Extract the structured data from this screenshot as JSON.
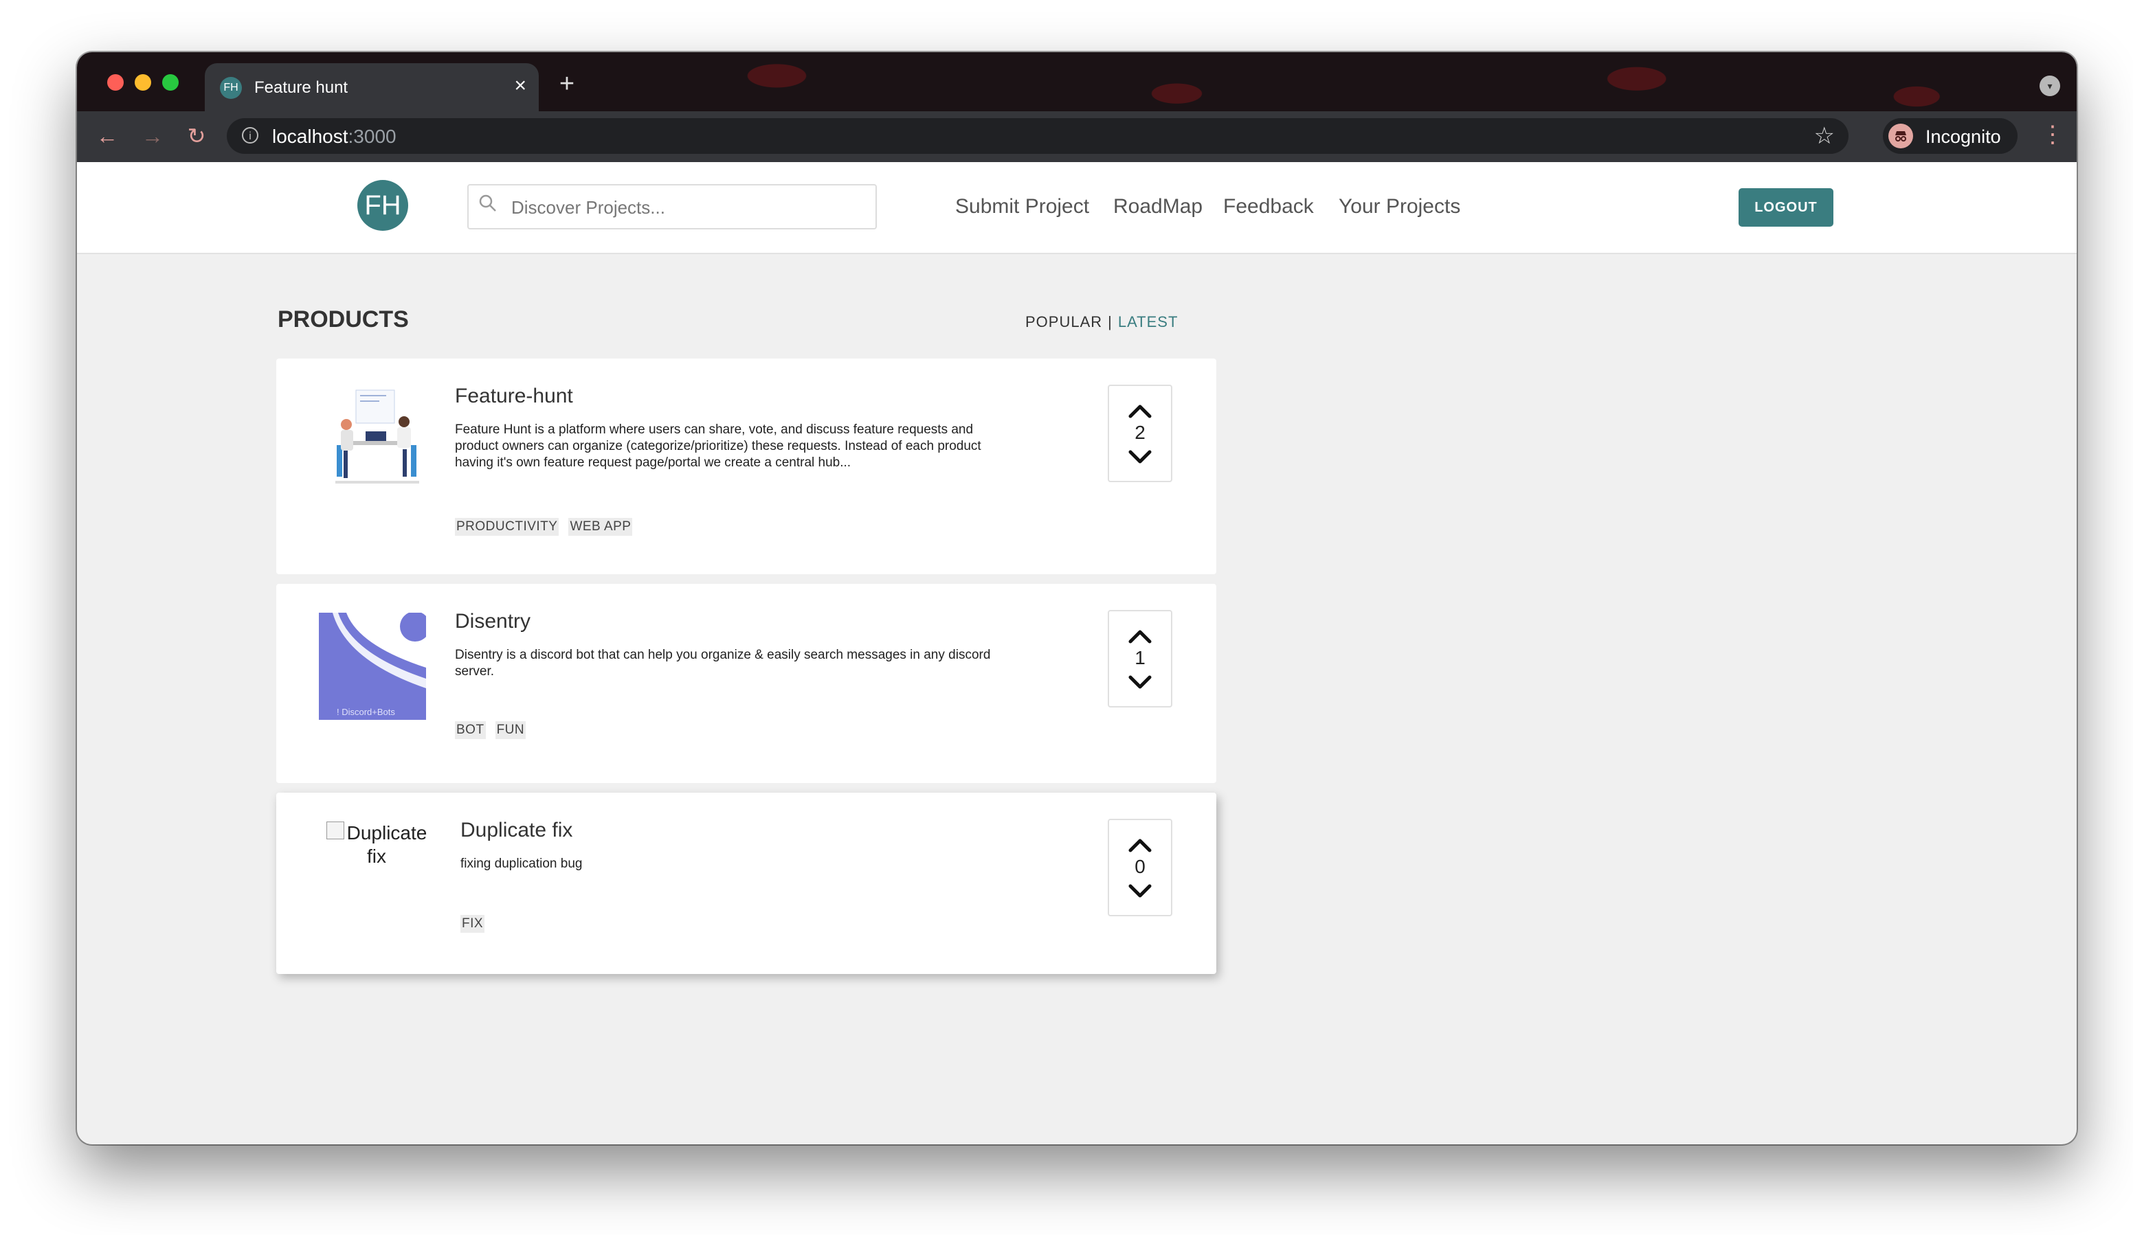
{
  "browser": {
    "tab_title": "Feature hunt",
    "tab_favicon": "FH",
    "close_glyph": "×",
    "new_tab_glyph": "+",
    "url_host": "localhost",
    "url_port": ":3000",
    "incognito_label": "Incognito"
  },
  "header": {
    "logo_text": "FH",
    "search_placeholder": "Discover Projects...",
    "nav": [
      "Submit Project",
      "RoadMap",
      "Feedback",
      "Your Projects"
    ],
    "logout_label": "LOGOUT"
  },
  "main": {
    "section_title": "PRODUCTS",
    "sort_popular": "POPULAR",
    "sort_separator": "|",
    "sort_latest": "LATEST",
    "products": [
      {
        "title": "Feature-hunt",
        "description": "Feature Hunt is a platform where users can share, vote, and discuss feature requests and product owners can organize (categorize/prioritize) these requests. Instead of each product having it's own feature request page/portal we create a central hub...",
        "tags": [
          "PRODUCTIVITY",
          "WEB APP"
        ],
        "votes": "2"
      },
      {
        "title": "Disentry",
        "description": "Disentry is a discord bot that can help you organize & easily search messages in any discord server.",
        "tags": [
          "BOT",
          "FUN"
        ],
        "votes": "1",
        "thumb_caption": "! Discord+Bots"
      },
      {
        "title": "Duplicate fix",
        "description": "fixing duplication bug",
        "tags": [
          "FIX"
        ],
        "votes": "0",
        "broken_image_alt": "Duplicate fix"
      }
    ]
  },
  "icons": {
    "back": "arrow-left-icon",
    "forward": "arrow-right-icon",
    "reload": "reload-icon",
    "info": "info-icon",
    "bookmark": "star-icon",
    "menu": "kebab-menu-icon",
    "search": "search-icon",
    "upvote": "chevron-up-icon",
    "downvote": "chevron-down-icon"
  },
  "colors": {
    "brand": "#3a7d80",
    "page_background": "#f0f0f0"
  }
}
